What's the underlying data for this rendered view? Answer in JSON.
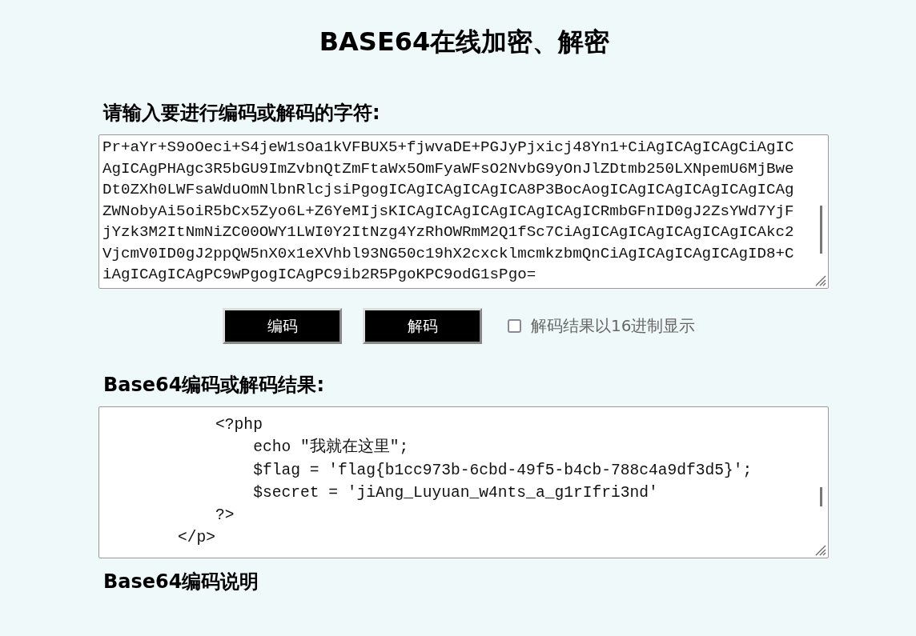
{
  "title": "BASE64在线加密、解密",
  "input_label": "请输入要进行编码或解码的字符:",
  "input_lines": [
    "Pr+aYr+S9oOeci+S4jeW1sOa1kVFBUX5+fjwvaDE+PGJyPjxicj48Yn1+CiAgICAgICAgCiAgIC",
    "AgICAgPHAgc3R5bGU9ImZvbnQtZmFtaWx5OmFyaWFsO2NvbG9yOnJlZDtmb250LXNpemU6MjBwe",
    "Dt0ZXh0LWFsaWduOmNlbnRlcjsiPgogICAgICAgICAgICA8P3BocAogICAgICAgICAgICAgICAg",
    "ZWNobyAi5oiR5bCx5Zyo6L+Z6YeMIjsKICAgICAgICAgICAgICAgICRmbGFnID0gJ2ZsYWd7YjF",
    "jYzk3M2ItNmNiZC00OWY1LWI0Y2ItNzg4YzRhOWRmM2Q1fSc7CiAgICAgICAgICAgICAgICAkc2",
    "VjcmV0ID0gJ2ppQW5nX0x1eXVhbl93NG50c19hX2cxcklmcmkzbmQnCiAgICAgICAgICAgID8+C",
    "iAgICAgICAgPC9wPgogICAgPC9ib2R5PgoKPC9odG1sPgo="
  ],
  "buttons": [
    {
      "label": "编码"
    },
    {
      "label": "解码"
    }
  ],
  "hex_option": {
    "label": "解码结果以16进制显示",
    "checked": false
  },
  "result_label": "Base64编码或解码结果:",
  "result_lines": [
    "            <?php",
    "                echo \"我就在这里\";",
    "                $flag = 'flag{b1cc973b-6cbd-49f5-b4cb-788c4a9df3d5}';",
    "                $secret = 'jiAng_Luyuan_w4nts_a_g1rIfri3nd'",
    "            ?>",
    "        </p>"
  ],
  "notes_heading": "Base64编码说明"
}
